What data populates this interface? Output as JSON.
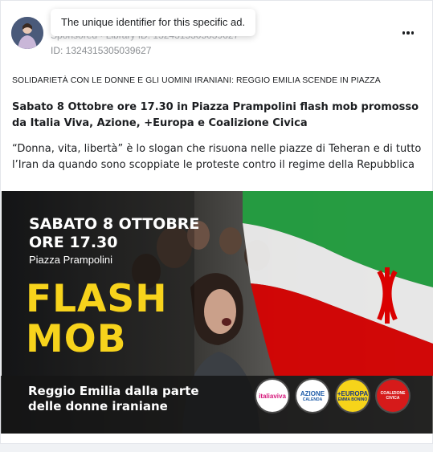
{
  "ad": {
    "sponsored_text": "Sponsored · Library ID: 1324315305039627",
    "ad_id": "ID: 1324315305039627",
    "tooltip": "The unique identifier for this specific ad.",
    "headline_small": "SOLIDARIETÀ CON LE DONNE E GLI UOMINI IRANIANI: REGGIO EMILIA SCENDE IN PIAZZA",
    "headline_bold": "Sabato 8 Ottobre ore 17.30 in Piazza Prampolini flash mob promosso da Italia Viva, Azione, +Europa e Coalizione Civica",
    "body_text": "“Donna, vita, libertà” è lo slogan che risuona nelle piazze di Teheran e di tutto l’Iran da quando sono scoppiate le proteste contro il regime della Repubblica islamica i…"
  },
  "creative": {
    "date_line1": "SABATO 8 OTTOBRE",
    "date_line2": "ORE 17.30",
    "place": "Piazza Prampolini",
    "flash_line1": "FLASH",
    "flash_line2": "MOB",
    "slogan_line1": "Reggio Emilia dalla parte",
    "slogan_line2": "delle donne iraniane",
    "logos": [
      {
        "name": "italiaviva",
        "l1": "italiaviva",
        "l2": ""
      },
      {
        "name": "azione",
        "l1": "AZIONE",
        "l2": "CALENDA"
      },
      {
        "name": "europa",
        "l1": "+EUROPA",
        "l2": "EMMA BONINO"
      },
      {
        "name": "coalizione",
        "l1": "",
        "l2": "COALIZIONE CIVICA"
      }
    ]
  },
  "colors": {
    "accent_yellow": "#f7d31c",
    "iran_green": "#239f40",
    "iran_red": "#da0000"
  },
  "icons": {
    "more": "more-dots-icon"
  }
}
